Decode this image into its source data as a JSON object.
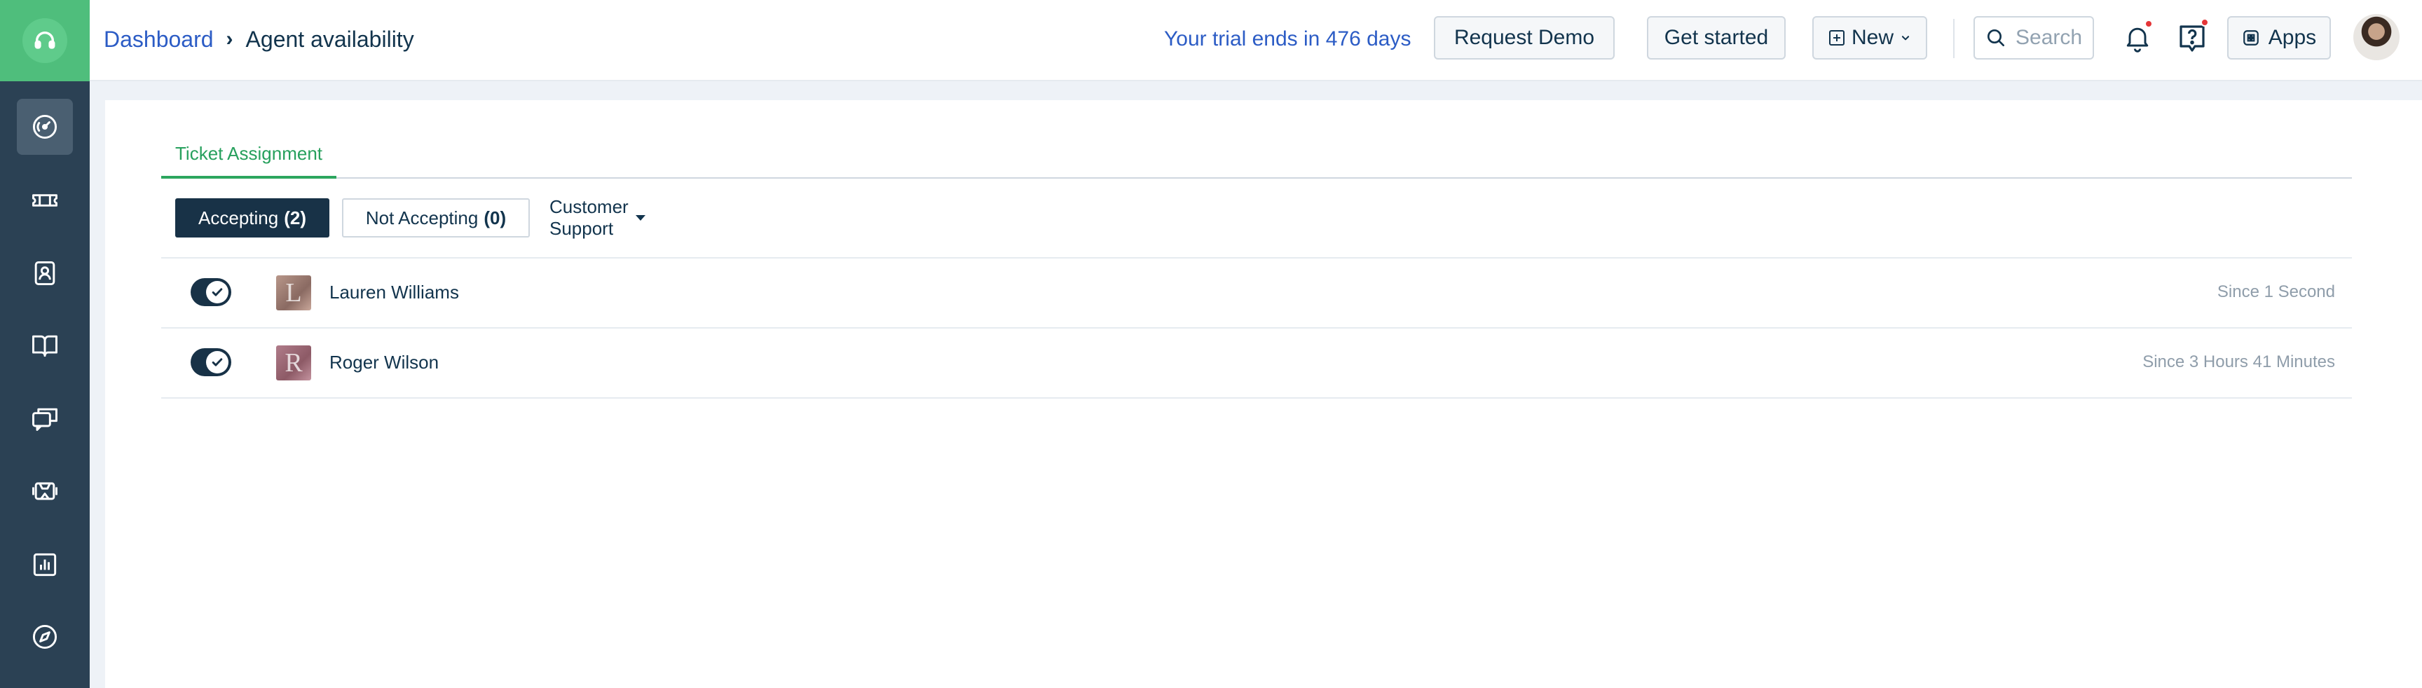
{
  "sidebar": {
    "logo_icon": "headset-icon",
    "items": [
      {
        "icon": "dashboard-icon",
        "active": true
      },
      {
        "icon": "ticket-icon",
        "active": false
      },
      {
        "icon": "contact-icon",
        "active": false
      },
      {
        "icon": "book-icon",
        "active": false
      },
      {
        "icon": "chat-icon",
        "active": false
      },
      {
        "icon": "robot-icon",
        "active": false
      },
      {
        "icon": "reports-icon",
        "active": false
      },
      {
        "icon": "compass-icon",
        "active": false
      }
    ]
  },
  "header": {
    "breadcrumb_root": "Dashboard",
    "breadcrumb_sep": "›",
    "page_title": "Agent availability",
    "trial_text": "Your trial ends in 476 days",
    "request_demo": "Request Demo",
    "get_started": "Get started",
    "new_label": "New",
    "search_placeholder": "Search",
    "apps_label": "Apps"
  },
  "tabs": {
    "active_label": "Ticket Assignment"
  },
  "filters": {
    "accepting_label": "Accepting",
    "accepting_count": "(2)",
    "not_accepting_label": "Not Accepting",
    "not_accepting_count": "(0)",
    "group_label": "Customer Support"
  },
  "agents": [
    {
      "initial": "L",
      "name": "Lauren Williams",
      "since": "Since 1 Second",
      "accepting": true
    },
    {
      "initial": "R",
      "name": "Roger Wilson",
      "since": "Since 3 Hours 41 Minutes",
      "accepting": true
    }
  ],
  "colors": {
    "sidebar": "#2b4154",
    "brand_green": "#4fbe7c",
    "link_blue": "#2c5cc5",
    "dark_navy": "#183247",
    "tab_green": "#27a05d"
  }
}
